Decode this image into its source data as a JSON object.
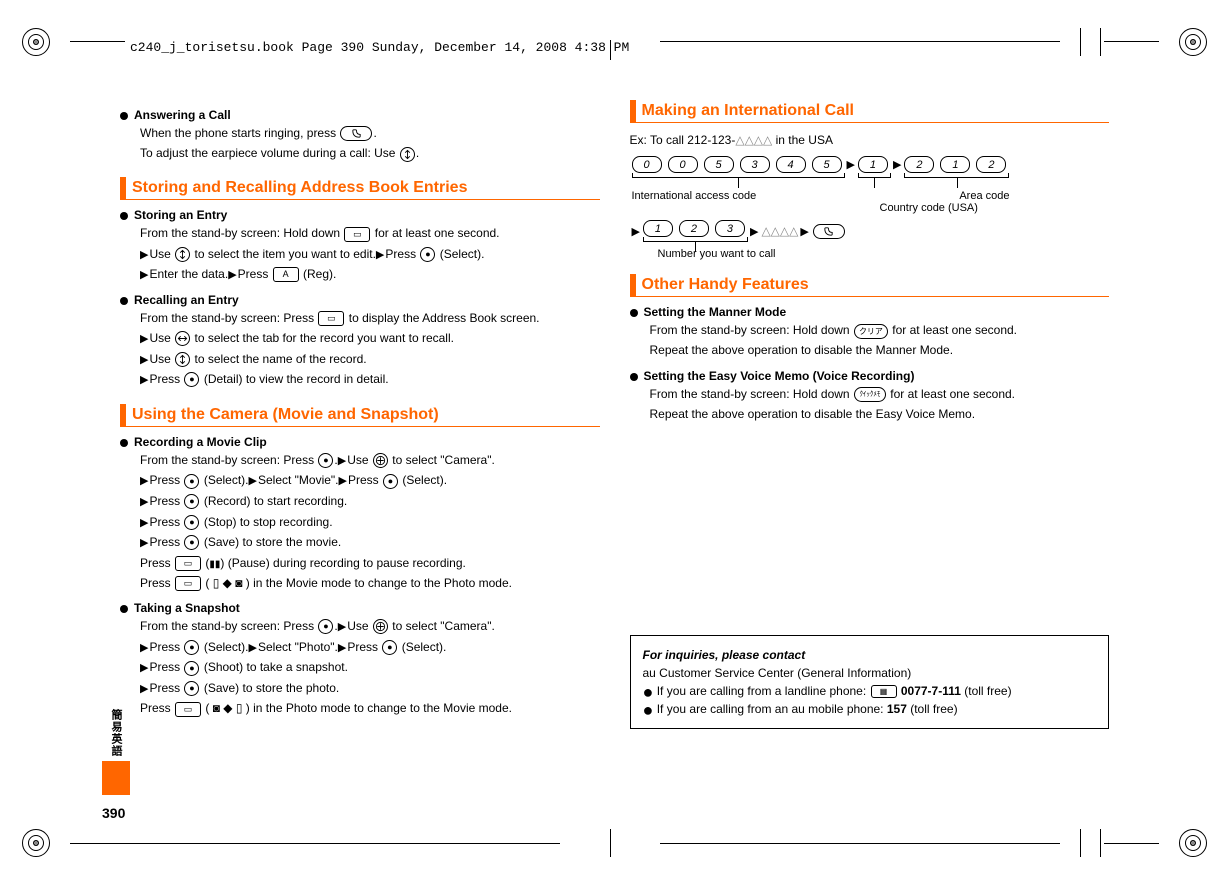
{
  "header_meta": "c240_j_torisetsu.book  Page 390  Sunday, December 14, 2008  4:38 PM",
  "page_num": "390",
  "side_tab_kanji": "簡易英語",
  "left": {
    "answer": {
      "title": "Answering a Call",
      "l1a": "When the phone starts ringing, press ",
      "l1b": ".",
      "l2a": "To adjust the earpiece volume during a call: Use ",
      "l2b": "."
    },
    "storing_title": "Storing and Recalling Address Book Entries",
    "storing": {
      "title": "Storing an Entry",
      "l1a": "From the stand-by screen: Hold down ",
      "l1b": " for at least one second.",
      "l2a": "Use ",
      "l2b": " to select the item you want to edit.",
      "l2c": "Press ",
      "l2d": " (Select).",
      "l3a": "Enter the data.",
      "l3b": "Press ",
      "l3c": " (Reg)."
    },
    "recall": {
      "title": "Recalling an Entry",
      "l1a": "From the stand-by screen: Press ",
      "l1b": " to display the Address Book screen.",
      "l2a": "Use ",
      "l2b": " to select the tab for the record you want to recall.",
      "l3a": "Use ",
      "l3b": " to select the name of the record.",
      "l4a": "Press ",
      "l4b": " (Detail) to view the record in detail."
    },
    "camera_title": "Using the Camera (Movie and Snapshot)",
    "movie": {
      "title": "Recording a Movie Clip",
      "l1a": "From the stand-by screen: Press ",
      "l1b": ".",
      "l1c": "Use ",
      "l1d": " to select \"Camera\".",
      "l2a": "Press ",
      "l2b": " (Select).",
      "l2c": "Select \"Movie\".",
      "l2d": "Press ",
      "l2e": " (Select).",
      "l3a": "Press ",
      "l3b": " (Record) to start recording.",
      "l4a": "Press ",
      "l4b": " (Stop) to stop recording.",
      "l5a": "Press ",
      "l5b": " (Save) to store the movie.",
      "l6a": "Press ",
      "l6b": " (",
      "l6c": ") (Pause) during recording to pause recording.",
      "l7a": "Press ",
      "l7b": " ( ",
      "l7c": " ) in the Movie mode to change to the Photo mode."
    },
    "photo": {
      "title": "Taking a Snapshot",
      "l1a": "From the stand-by screen: Press ",
      "l1b": ".",
      "l1c": "Use ",
      "l1d": " to select \"Camera\".",
      "l2a": "Press ",
      "l2b": " (Select).",
      "l2c": "Select \"Photo\".",
      "l2d": "Press ",
      "l2e": " (Select).",
      "l3a": "Press ",
      "l3b": " (Shoot) to take a snapshot.",
      "l4a": "Press ",
      "l4b": " (Save) to store the photo.",
      "l5a": "Press ",
      "l5b": " ( ",
      "l5c": " ) in the Photo mode to change to the Movie mode."
    }
  },
  "right": {
    "intl_title": "Making an International Call",
    "ex_a": "Ex: To call 212-123-",
    "ex_b": " in the USA",
    "intl_access": "International access code",
    "area_code": "Area code",
    "country_code": "Country code (USA)",
    "number_call": "Number you want to call",
    "digits_row1_g1": [
      "0",
      "0",
      "5",
      "3",
      "4",
      "5"
    ],
    "digits_row1_g2": [
      "1"
    ],
    "digits_row1_g3": [
      "2",
      "1",
      "2"
    ],
    "digits_row2_g1": [
      "1",
      "2",
      "3"
    ],
    "other_title": "Other Handy Features",
    "manner": {
      "title": "Setting the Manner Mode",
      "l1a": "From the stand-by screen: Hold down ",
      "l1b": " for at least one second.",
      "l2": "Repeat the above operation to disable the Manner Mode."
    },
    "memo": {
      "title": "Setting the Easy Voice Memo (Voice Recording)",
      "l1a": "From the stand-by screen: Hold down ",
      "l1b": " for at least one second.",
      "l2": "Repeat the above operation to disable the Easy Voice Memo."
    },
    "key_clear": "クリア",
    "key_memo": "ｸｲｯｸﾒﾓ",
    "inquiries": {
      "hdr": "For inquiries, please contact",
      "sub": "au Customer Service Center (General Information)",
      "line1a": "If you are calling from a landline phone: ",
      "tel1": "0077-7-111",
      "toll1": " (toll free)",
      "line2a": "If you are calling from an au mobile phone: ",
      "tel2": "157",
      "toll2": " (toll free)"
    }
  }
}
